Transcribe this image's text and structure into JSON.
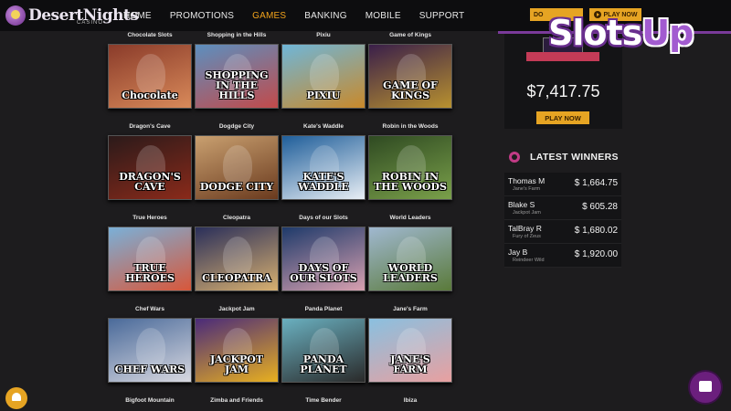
{
  "header": {
    "logo_text": "DesertNights",
    "logo_sub": "CASINO",
    "nav": [
      "HOME",
      "PROMOTIONS",
      "GAMES",
      "BANKING",
      "MOBILE",
      "SUPPORT"
    ],
    "active_nav": "GAMES",
    "download_label": "DO",
    "play_now_label": "PLAY NOW"
  },
  "brand_overlay": {
    "part1": "Slots",
    "part2": "Up"
  },
  "games": [
    {
      "title": "Chocolate Slots",
      "logo": "Chocolate"
    },
    {
      "title": "Shopping in the Hills",
      "logo": "SHOPPING IN THE HILLS"
    },
    {
      "title": "Pixiu",
      "logo": "PIXIU"
    },
    {
      "title": "Game of Kings",
      "logo": "GAME OF KINGS"
    },
    {
      "title": "Dragon's Cave",
      "logo": "DRAGON'S CAVE"
    },
    {
      "title": "Dogdge City",
      "logo": "DODGE CITY"
    },
    {
      "title": "Kate's Waddle",
      "logo": "KATE'S WADDLE"
    },
    {
      "title": "Robin in the Woods",
      "logo": "ROBIN IN THE WOODS"
    },
    {
      "title": "True Heroes",
      "logo": "TRUE HEROES"
    },
    {
      "title": "Cleopatra",
      "logo": "CLEOPATRA"
    },
    {
      "title": "Days of our Slots",
      "logo": "DAYS OF OUR SLOTS"
    },
    {
      "title": "World Leaders",
      "logo": "WORLD LEADERS"
    },
    {
      "title": "Chef Wars",
      "logo": "CHEF WARS"
    },
    {
      "title": "Jackpot Jam",
      "logo": "JACKPOT JAM"
    },
    {
      "title": "Panda Planet",
      "logo": "PANDA PLANET"
    },
    {
      "title": "Jane's Farm",
      "logo": "JANE'S FARM"
    },
    {
      "title": "Bigfoot Mountain",
      "logo": ""
    },
    {
      "title": "Zimba and Friends",
      "logo": ""
    },
    {
      "title": "Time Bender",
      "logo": ""
    },
    {
      "title": "Ibiza",
      "logo": ""
    }
  ],
  "jackpot": {
    "amount": "$7,417.75",
    "play_label": "PLAY NOW"
  },
  "winners": {
    "title": "LATEST WINNERS",
    "rows": [
      {
        "name": "Thomas M",
        "game": "Jane's Farm",
        "amount": "$ 1,664.75"
      },
      {
        "name": "Blake S",
        "game": "Jackpot Jam",
        "amount": "$ 605.28"
      },
      {
        "name": "TalBray R",
        "game": "Fury of Zeus",
        "amount": "$ 1,680.02"
      },
      {
        "name": "Jay B",
        "game": "Reindeer Wild",
        "amount": "$ 1,920.00"
      }
    ]
  },
  "colors": {
    "accent": "#e6a423",
    "nav_active": "#f2a31b",
    "purple": "#7a3a9a",
    "background": "#1d1c1e"
  },
  "icons": [
    "bell-icon",
    "chat-icon",
    "play-icon",
    "winners-icon"
  ]
}
